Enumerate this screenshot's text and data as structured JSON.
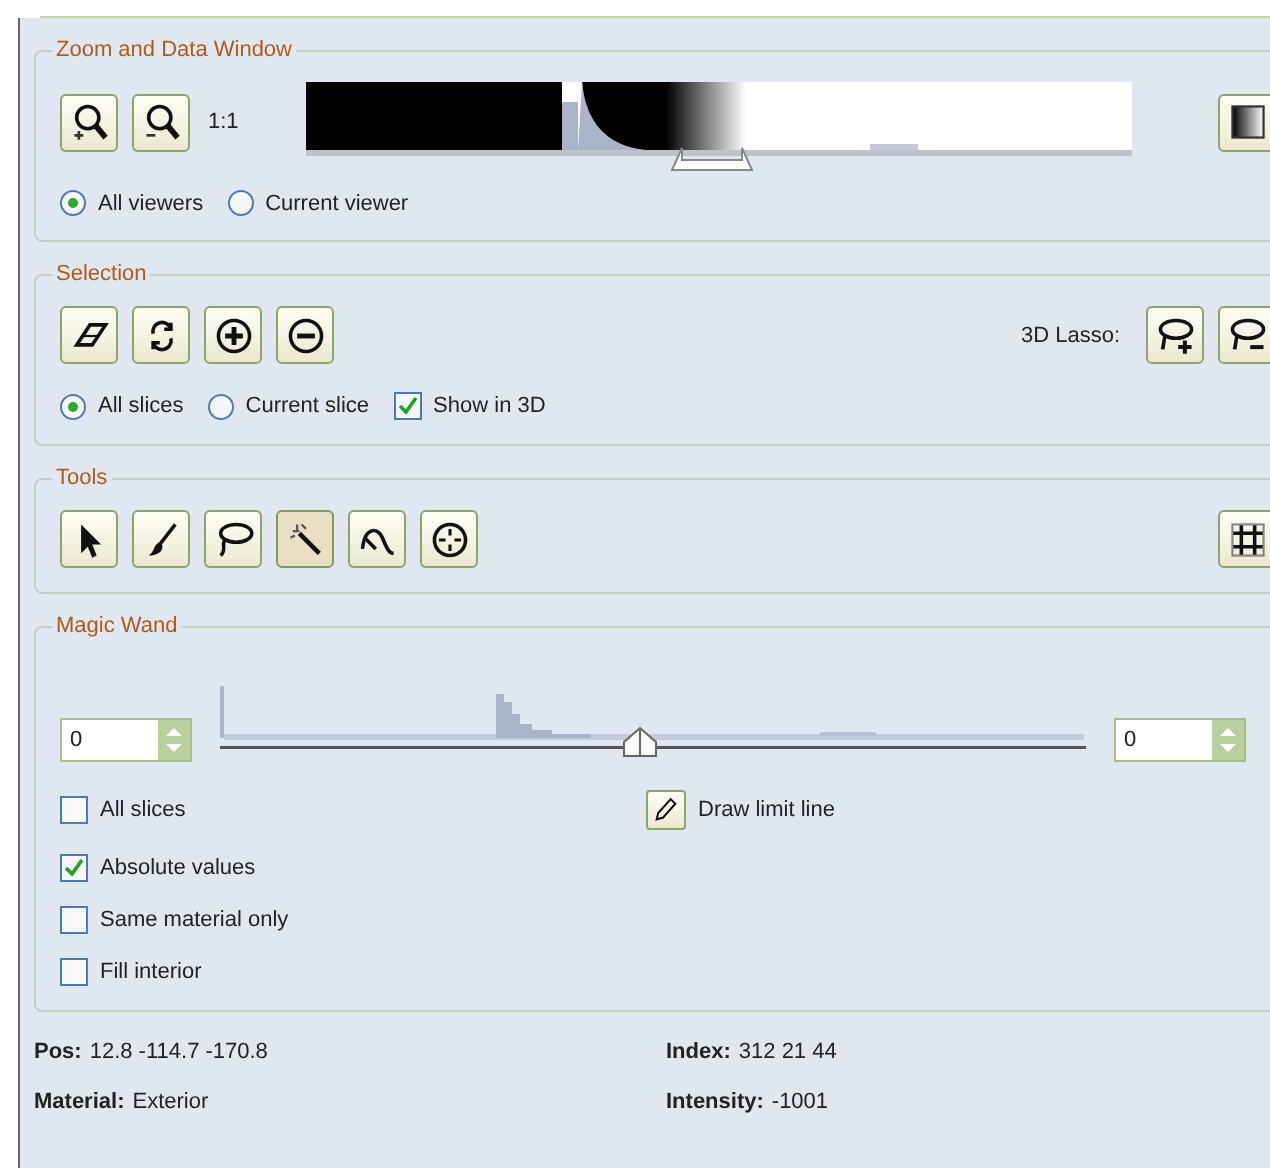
{
  "zoom_window": {
    "title": "Zoom and Data Window",
    "buttons": [
      {
        "kind": "zoom_in"
      },
      {
        "kind": "zoom_out"
      }
    ],
    "ratio": "1:1",
    "slider": {
      "level": 0.49
    },
    "side_button": {
      "kind": "gradient"
    },
    "scope": [
      {
        "label": "All viewers",
        "selected": true
      },
      {
        "label": "Current viewer",
        "selected": false
      }
    ]
  },
  "selection": {
    "title": "Selection",
    "buttons": [
      {
        "kind": "eraser"
      },
      {
        "kind": "invert"
      },
      {
        "kind": "add"
      },
      {
        "kind": "subtract"
      }
    ],
    "lasso_label": "3D Lasso:",
    "lasso_buttons": [
      {
        "kind": "lasso_add"
      },
      {
        "kind": "lasso_remove"
      }
    ],
    "scope": [
      {
        "label": "All slices",
        "selected": true
      },
      {
        "label": "Current slice",
        "selected": false
      }
    ],
    "show_in_3d": {
      "label": "Show in 3D",
      "checked": true
    }
  },
  "tools": {
    "title": "Tools",
    "items": [
      {
        "kind": "pointer",
        "selected": false
      },
      {
        "kind": "brush",
        "selected": false
      },
      {
        "kind": "lasso",
        "selected": false
      },
      {
        "kind": "wand",
        "selected": true
      },
      {
        "kind": "curve",
        "selected": false
      },
      {
        "kind": "target",
        "selected": false
      }
    ],
    "side_button": {
      "kind": "grid"
    }
  },
  "magic_wand": {
    "title": "Magic Wand",
    "low": "0",
    "high": "0",
    "slider": {
      "level": 0.485
    },
    "options": [
      {
        "label": "All slices",
        "checked": false
      },
      {
        "label": "Absolute values",
        "checked": true
      },
      {
        "label": "Same material only",
        "checked": false
      },
      {
        "label": "Fill interior",
        "checked": false
      }
    ],
    "draw_limit_line": {
      "kind": "pencil",
      "label": "Draw limit line"
    }
  },
  "status": [
    {
      "label": "Pos:",
      "value": "12.8 -114.7 -170.8"
    },
    {
      "label": "Index:",
      "value": "312 21 44"
    },
    {
      "label": "Material:",
      "value": "Exterior"
    },
    {
      "label": "Intensity:",
      "value": "-1001"
    }
  ]
}
